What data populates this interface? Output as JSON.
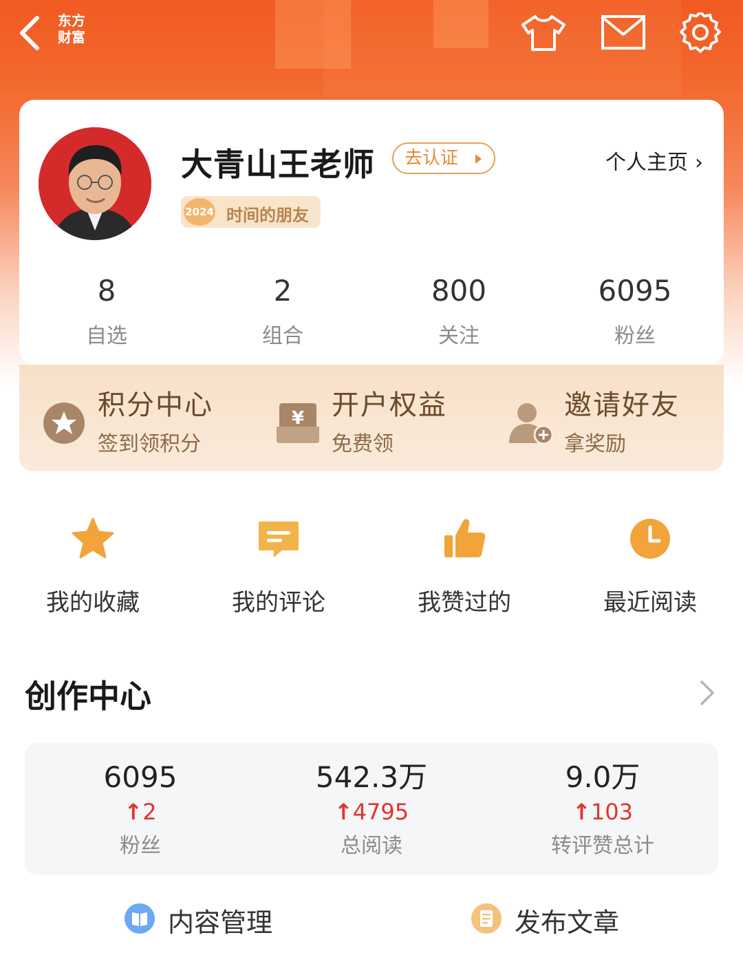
{
  "colors": {
    "brand": "#f15a22",
    "accent_orange": "#f0a33a",
    "benefit_bg": "#f7e0c8",
    "up_red": "#e5322d"
  },
  "nav": {
    "logo_line1": "东方",
    "logo_line2": "财富",
    "icons": [
      "back-arrow-icon",
      "shirt-icon",
      "mail-icon",
      "settings-gear-icon"
    ]
  },
  "profile": {
    "name": "大青山王老师",
    "verify_label": "去认证",
    "homepage_label": "个人主页",
    "badge_year": "2024",
    "badge_text": "时间的朋友",
    "stats": [
      {
        "value": "8",
        "label": "自选"
      },
      {
        "value": "2",
        "label": "组合"
      },
      {
        "value": "800",
        "label": "关注"
      },
      {
        "value": "6095",
        "label": "粉丝"
      }
    ]
  },
  "benefits": [
    {
      "title": "积分中心",
      "subtitle": "签到领积分",
      "icon": "points-star-icon"
    },
    {
      "title": "开户权益",
      "subtitle": "免费领",
      "icon": "yuan-envelope-icon"
    },
    {
      "title": "邀请好友",
      "subtitle": "拿奖励",
      "icon": "add-friend-icon"
    }
  ],
  "quick_links": [
    {
      "label": "我的收藏",
      "icon": "star-icon"
    },
    {
      "label": "我的评论",
      "icon": "comment-icon"
    },
    {
      "label": "我赞过的",
      "icon": "thumbs-up-icon"
    },
    {
      "label": "最近阅读",
      "icon": "clock-icon"
    }
  ],
  "creation": {
    "title": "创作中心",
    "stats": [
      {
        "value": "6095",
        "delta": "2",
        "label": "粉丝"
      },
      {
        "value": "542.3万",
        "delta": "4795",
        "label": "总阅读"
      },
      {
        "value": "9.0万",
        "delta": "103",
        "label": "转评赞总计"
      }
    ],
    "actions": [
      {
        "label": "内容管理",
        "icon": "content-manage-icon",
        "color": "#6ea8f5"
      },
      {
        "label": "发布文章",
        "icon": "publish-article-icon",
        "color": "#f4c27c"
      }
    ]
  }
}
